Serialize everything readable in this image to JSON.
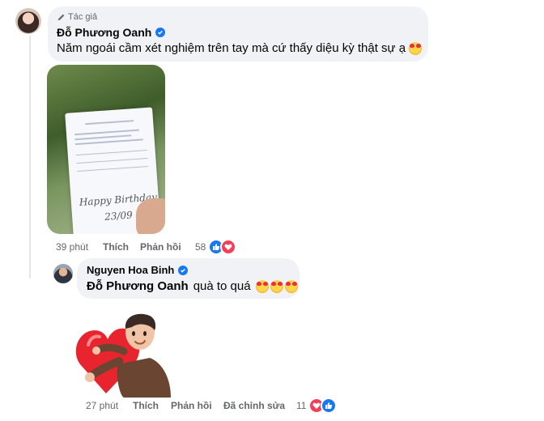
{
  "comment1": {
    "author_badge": "Tác giả",
    "author": "Đỗ Phương Oanh",
    "text": "Năm ngoái cầm xét nghiệm trên tay mà cứ thấy diệu kỳ thật sự ạ",
    "emoji": "smiling-face-with-hearts",
    "photo": {
      "alt_text_lines": [
        "Happy Birthday",
        "23/09"
      ]
    },
    "time": "39 phút",
    "like_label": "Thích",
    "reply_label": "Phản hồi",
    "reaction_count": "58",
    "reactions": [
      "like",
      "love"
    ]
  },
  "comment2": {
    "author": "Nguyen Hoa Binh",
    "mention": "Đỗ Phương Oanh",
    "text": "quà to quá",
    "emojis": [
      "smiling-face-with-hearts",
      "smiling-face-with-hearts",
      "smiling-face-with-hearts"
    ],
    "sticker": "heart-hug-sticker"
  },
  "comment3": {
    "time": "27 phút",
    "like_label": "Thích",
    "reply_label": "Phản hồi",
    "edited_label": "Đã chỉnh sửa",
    "reaction_count": "11",
    "reactions": [
      "love",
      "like"
    ]
  },
  "colors": {
    "bubble": "#f0f2f5",
    "meta_text": "#65676b",
    "like_blue": "#1877f2",
    "love_red": "#f33e58"
  }
}
